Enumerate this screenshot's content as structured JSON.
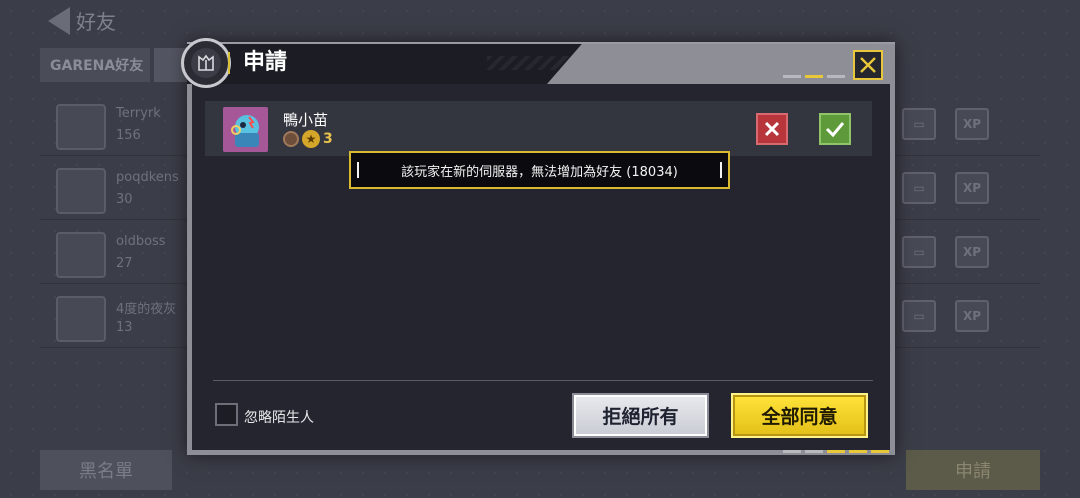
{
  "background": {
    "title": "好友",
    "tab_label": "GARENA好友",
    "rows": [
      {
        "name": "Terryrk",
        "sub": "156"
      },
      {
        "name": "poqdkens",
        "sub": "30"
      },
      {
        "name": "oldboss",
        "sub": "27"
      },
      {
        "name": "4度的夜灰",
        "sub": "13"
      }
    ],
    "bottom_left_label": "黑名單",
    "bottom_right_label": "申請",
    "xp_label": "XP"
  },
  "dialog": {
    "title": "申請",
    "close_icon": "close-x-icon",
    "request": {
      "name": "鴨小苗",
      "level": "3"
    },
    "toast": "該玩家在新的伺服器，無法增加為好友 (18034)",
    "ignore_label": "忽略陌生人",
    "reject_all_label": "拒絕所有",
    "accept_all_label": "全部同意"
  },
  "colors": {
    "accent_yellow": "#e8c83a",
    "reject_red": "#b8353c",
    "accept_green": "#5f9a3a"
  }
}
